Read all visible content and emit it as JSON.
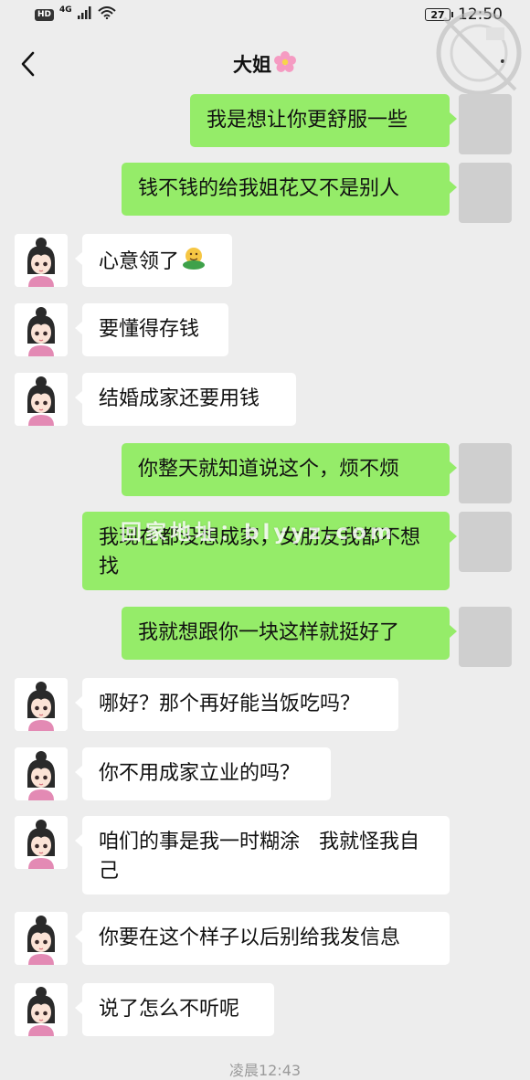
{
  "status_bar": {
    "hd": "HD",
    "network": "4G",
    "battery": "27",
    "time": "12:50"
  },
  "header": {
    "title": "大姐",
    "title_emoji": "flower-icon"
  },
  "messages": [
    {
      "side": "out",
      "text": "我是想让你更舒服一些"
    },
    {
      "side": "out",
      "text": "钱不钱的给我姐花又不是别人"
    },
    {
      "side": "in",
      "text": "心意领了"
    },
    {
      "side": "in",
      "text": "要懂得存钱"
    },
    {
      "side": "in",
      "text": "结婚成家还要用钱"
    },
    {
      "side": "out",
      "text": "你整天就知道说这个，烦不烦"
    },
    {
      "side": "out",
      "text": "我现在都没想成家，女朋友我都不想找"
    },
    {
      "side": "out",
      "text": "我就想跟你一块这样就挺好了"
    },
    {
      "side": "in",
      "text": "哪好？那个再好能当饭吃吗？"
    },
    {
      "side": "in",
      "text": "你不用成家立业的吗？"
    },
    {
      "side": "in",
      "text": "咱们的事是我一时糊涂   我就怪我自己"
    },
    {
      "side": "in",
      "text": "你要在这个样子以后别给我发信息"
    },
    {
      "side": "in",
      "text": "说了怎么不听呢"
    }
  ],
  "watermark": "回家地址：blyyz.com",
  "timestamp": "凌晨12:43",
  "colors": {
    "background": "#ededed",
    "outgoing_bubble": "#95ec69",
    "incoming_bubble": "#ffffff"
  }
}
